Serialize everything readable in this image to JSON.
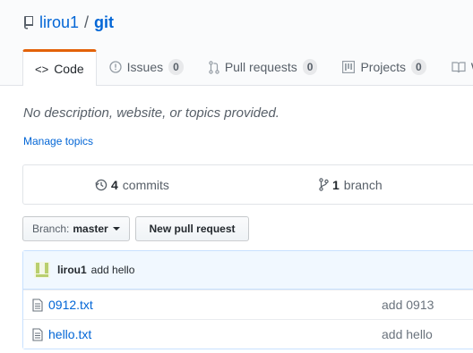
{
  "repo": {
    "owner": "lirou1",
    "separator": "/",
    "name": "git"
  },
  "tabs": [
    {
      "label": "Code",
      "icon": "code-icon"
    },
    {
      "label": "Issues",
      "count": "0",
      "icon": "issue-icon"
    },
    {
      "label": "Pull requests",
      "count": "0",
      "icon": "pull-request-icon"
    },
    {
      "label": "Projects",
      "count": "0",
      "icon": "project-icon"
    },
    {
      "label": "W",
      "icon": "wiki-icon"
    }
  ],
  "description": "No description, website, or topics provided.",
  "manage_topics": "Manage topics",
  "summary": {
    "commits_count": "4",
    "commits_label": "commits",
    "branch_count": "1",
    "branch_label": "branch"
  },
  "branch_button": {
    "prefix": "Branch:",
    "value": "master"
  },
  "new_pr_button": "New pull request",
  "latest_commit": {
    "author": "lirou1",
    "message": "add hello"
  },
  "files": [
    {
      "name": "0912.txt",
      "message": "add 0913"
    },
    {
      "name": "hello.txt",
      "message": "add hello"
    }
  ],
  "colors": {
    "link": "#0366d6",
    "tab_accent": "#e36209",
    "commit_bar": "#f1f8ff"
  }
}
